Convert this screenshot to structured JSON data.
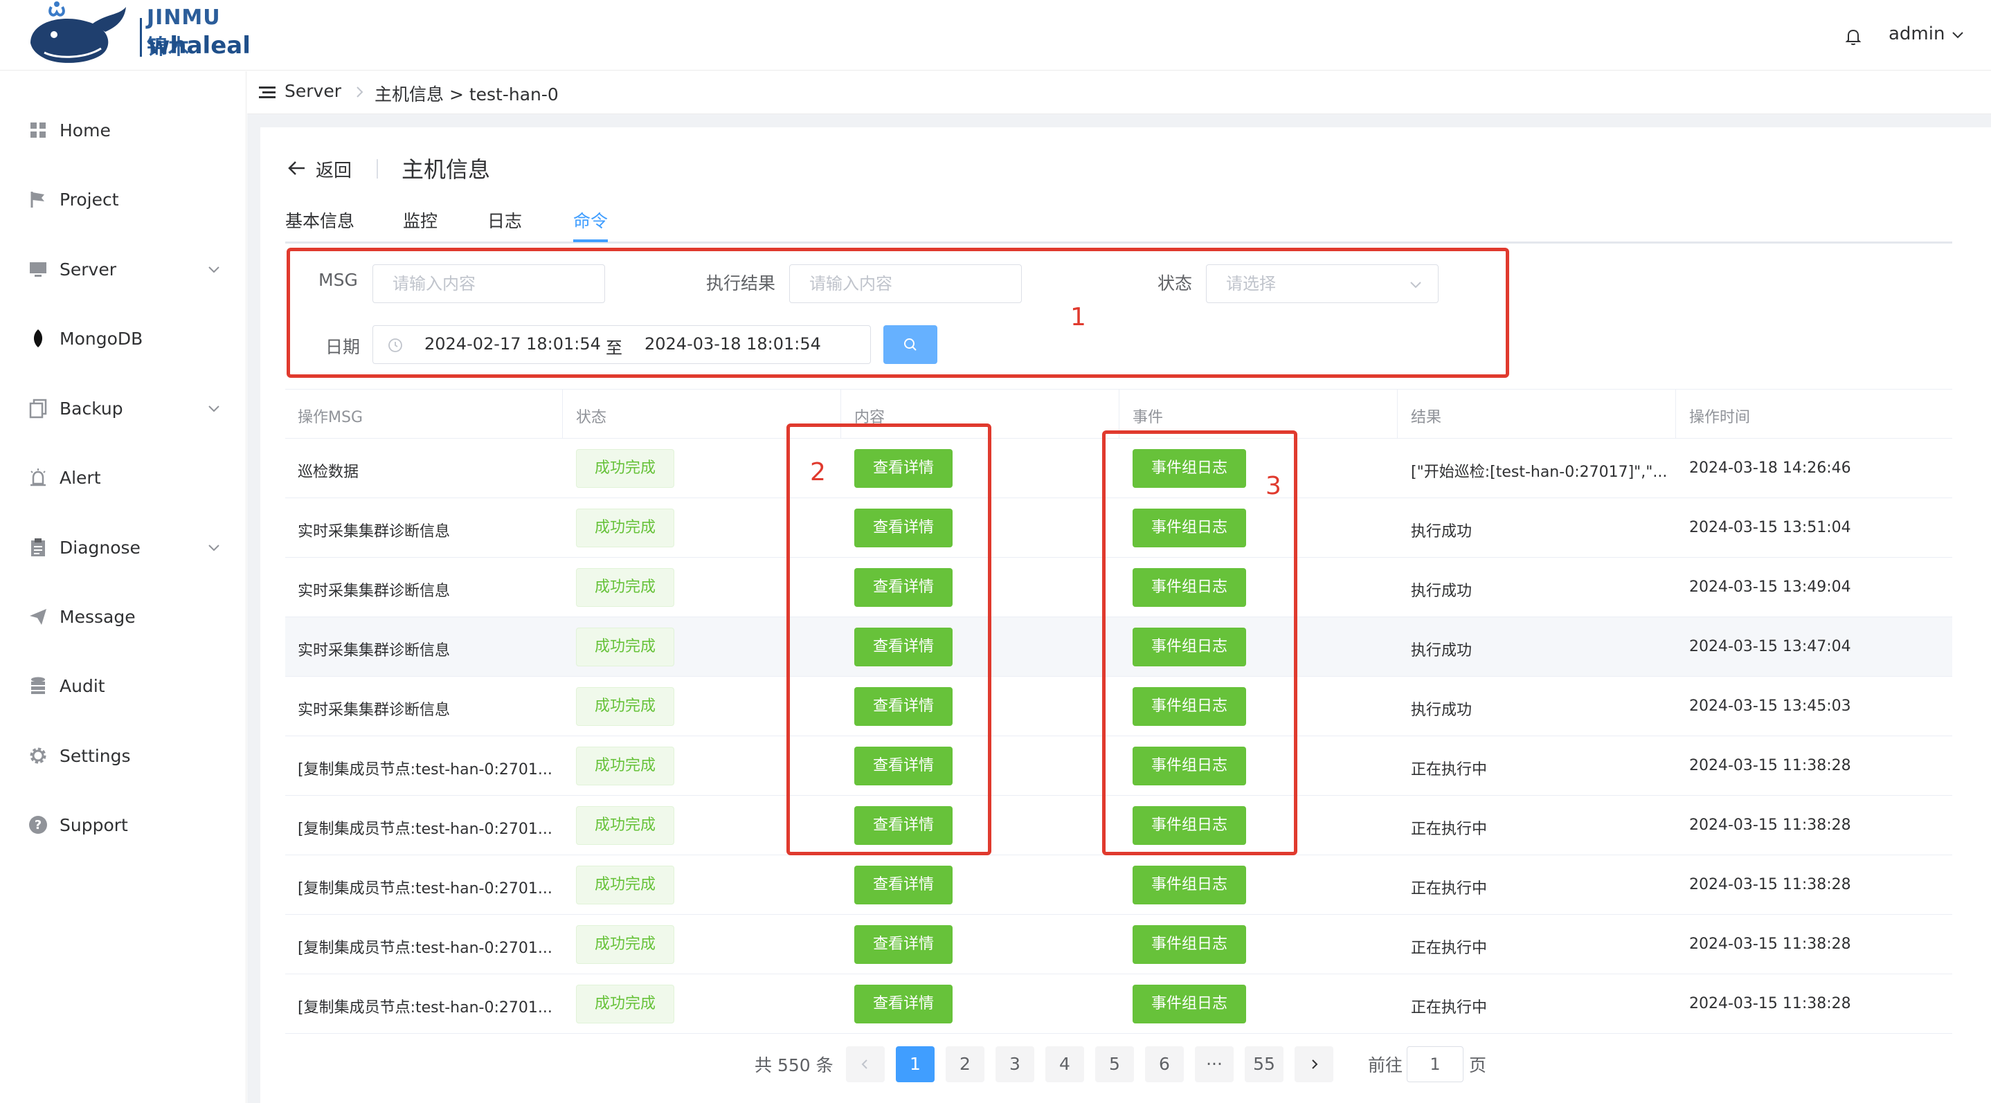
{
  "topbar": {
    "logo_top": "JINMU锦木",
    "logo_bottom": "whaleal",
    "user": "admin"
  },
  "sidebar": {
    "items": [
      {
        "label": "Home",
        "icon": "grid-icon",
        "expandable": false
      },
      {
        "label": "Project",
        "icon": "flag-icon",
        "expandable": false
      },
      {
        "label": "Server",
        "icon": "monitor-icon",
        "expandable": true
      },
      {
        "label": "MongoDB",
        "icon": "leaf-icon",
        "expandable": false
      },
      {
        "label": "Backup",
        "icon": "copy-icon",
        "expandable": true
      },
      {
        "label": "Alert",
        "icon": "alarm-icon",
        "expandable": false
      },
      {
        "label": "Diagnose",
        "icon": "clipboard-icon",
        "expandable": true
      },
      {
        "label": "Message",
        "icon": "send-icon",
        "expandable": false
      },
      {
        "label": "Audit",
        "icon": "database-icon",
        "expandable": false
      },
      {
        "label": "Settings",
        "icon": "gear-icon",
        "expandable": false
      },
      {
        "label": "Support",
        "icon": "question-icon",
        "expandable": false
      }
    ]
  },
  "breadcrumb": {
    "root": "Server",
    "path": "主机信息 > test-han-0"
  },
  "header": {
    "back_label": "返回",
    "title": "主机信息"
  },
  "tabs": [
    {
      "label": "基本信息",
      "active": false
    },
    {
      "label": "监控",
      "active": false
    },
    {
      "label": "日志",
      "active": false
    },
    {
      "label": "命令",
      "active": true
    }
  ],
  "filters": {
    "msg_label": "MSG",
    "msg_placeholder": "请输入内容",
    "result_label": "执行结果",
    "result_placeholder": "请输入内容",
    "status_label": "状态",
    "status_placeholder": "请选择",
    "date_label": "日期",
    "date_start": "2024-02-17 18:01:54",
    "date_sep": "至",
    "date_end": "2024-03-18 18:01:54"
  },
  "annotations": [
    "1",
    "2",
    "3"
  ],
  "table": {
    "columns": [
      "操作MSG",
      "状态",
      "内容",
      "事件",
      "结果",
      "操作时间"
    ],
    "detail_button": "查看详情",
    "event_button": "事件组日志",
    "rows": [
      {
        "msg": "巡检数据",
        "status": "成功完成",
        "result": "[\"开始巡检:[test-han-0:27017]\",\"...",
        "time": "2024-03-18 14:26:46"
      },
      {
        "msg": "实时采集集群诊断信息",
        "status": "成功完成",
        "result": "执行成功",
        "time": "2024-03-15 13:51:04"
      },
      {
        "msg": "实时采集集群诊断信息",
        "status": "成功完成",
        "result": "执行成功",
        "time": "2024-03-15 13:49:04"
      },
      {
        "msg": "实时采集集群诊断信息",
        "status": "成功完成",
        "result": "执行成功",
        "time": "2024-03-15 13:47:04"
      },
      {
        "msg": "实时采集集群诊断信息",
        "status": "成功完成",
        "result": "执行成功",
        "time": "2024-03-15 13:45:03"
      },
      {
        "msg": "[复制集成员节点:test-han-0:2701...",
        "status": "成功完成",
        "result": "正在执行中",
        "time": "2024-03-15 11:38:28"
      },
      {
        "msg": "[复制集成员节点:test-han-0:2701...",
        "status": "成功完成",
        "result": "正在执行中",
        "time": "2024-03-15 11:38:28"
      },
      {
        "msg": "[复制集成员节点:test-han-0:2701...",
        "status": "成功完成",
        "result": "正在执行中",
        "time": "2024-03-15 11:38:28"
      },
      {
        "msg": "[复制集成员节点:test-han-0:2701...",
        "status": "成功完成",
        "result": "正在执行中",
        "time": "2024-03-15 11:38:28"
      },
      {
        "msg": "[复制集成员节点:test-han-0:2701...",
        "status": "成功完成",
        "result": "正在执行中",
        "time": "2024-03-15 11:38:28"
      }
    ]
  },
  "pagination": {
    "total": "共 550 条",
    "pages": [
      "1",
      "2",
      "3",
      "4",
      "5",
      "6",
      "···",
      "55"
    ],
    "current": "1",
    "goto_label": "前往",
    "goto_value": "1",
    "page_label": "页"
  },
  "colors": {
    "primary": "#409eff",
    "success": "#67c23a",
    "annotation": "#e03a2e"
  }
}
